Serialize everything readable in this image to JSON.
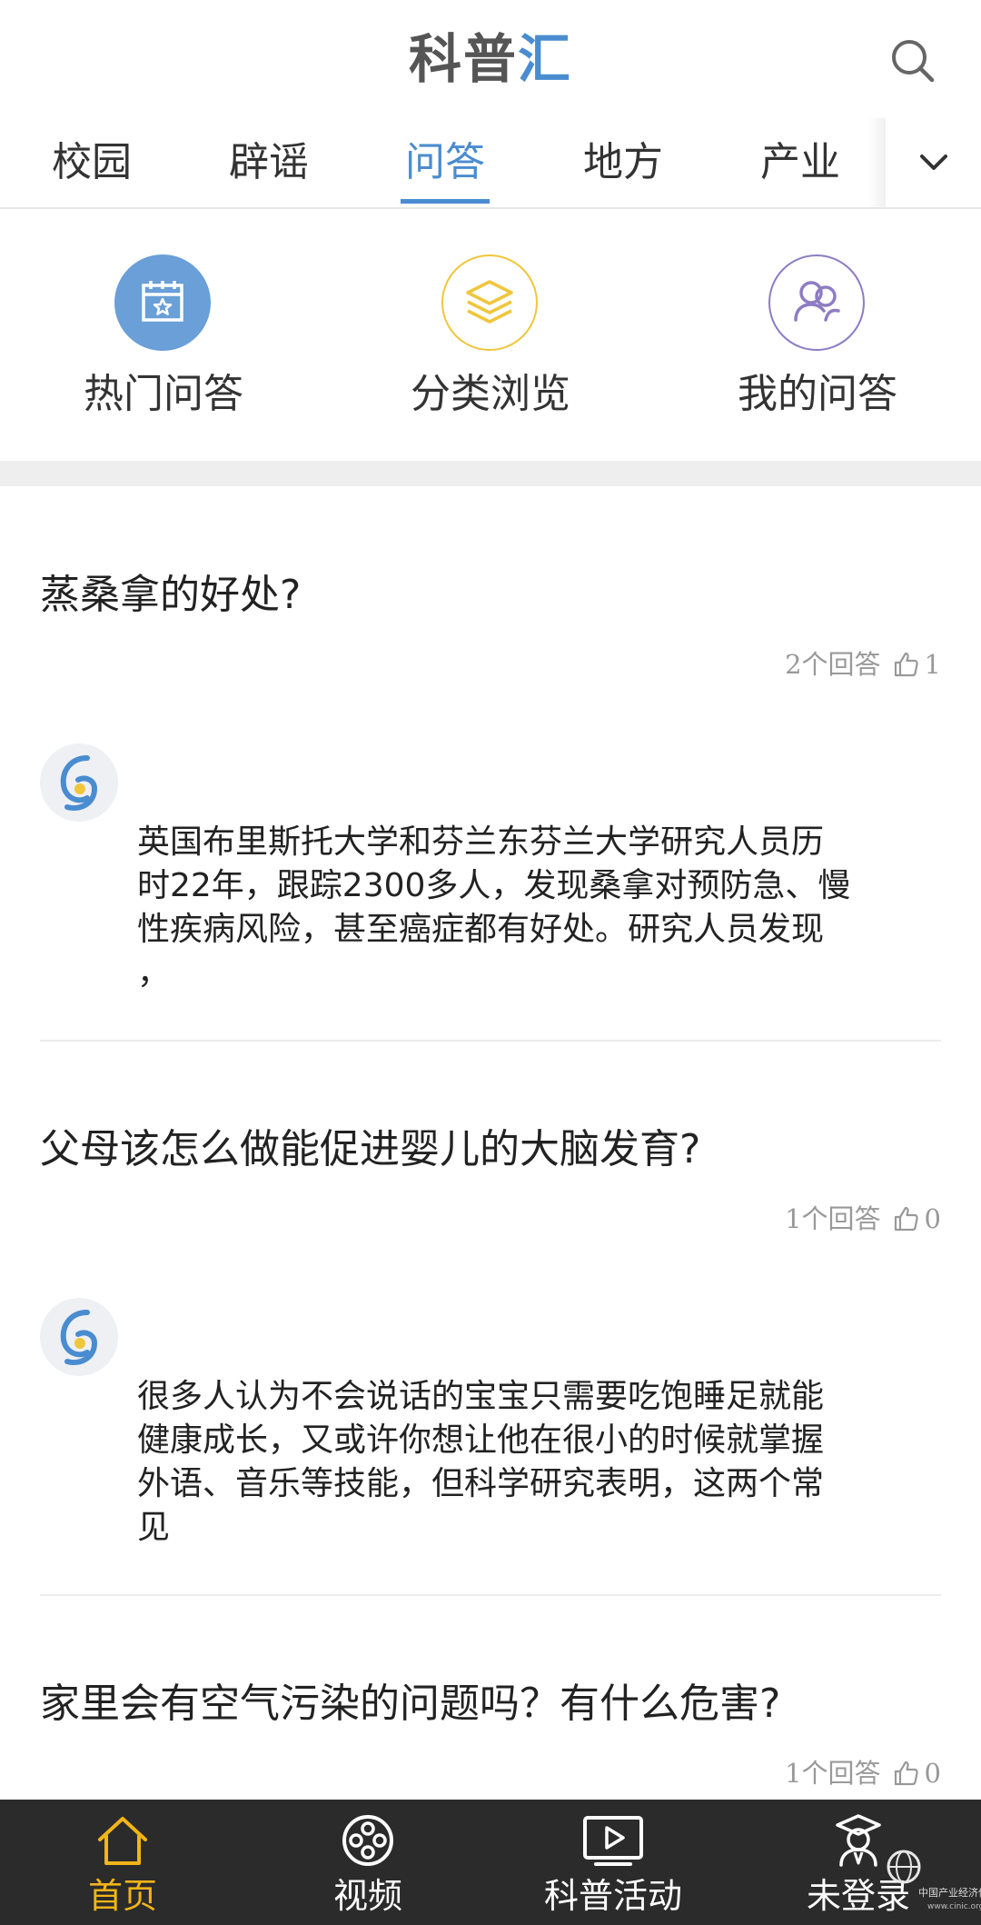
{
  "header": {
    "logo_part1": "科普",
    "logo_part2": "汇",
    "search_icon": "search-icon"
  },
  "tabs": [
    {
      "label": "校园",
      "active": false
    },
    {
      "label": "辟谣",
      "active": false
    },
    {
      "label": "问答",
      "active": true
    },
    {
      "label": "地方",
      "active": false
    },
    {
      "label": "产业",
      "active": false
    }
  ],
  "tabs_more_icon": "chevron-down-icon",
  "quick_entries": [
    {
      "label": "热门问答",
      "icon": "calendar-star-icon",
      "color": "#6a9fd8"
    },
    {
      "label": "分类浏览",
      "icon": "layers-icon",
      "color": "#f0c63c"
    },
    {
      "label": "我的问答",
      "icon": "users-icon",
      "color": "#8e7cc3"
    }
  ],
  "questions": [
    {
      "title": "蒸桑拿的好处?",
      "answers_count": "2个回答",
      "likes": "1",
      "answer_lines": [
        "英国布里斯托大学和芬兰东芬兰大学研究人员历",
        "时22年，跟踪2300多人，发现桑拿对预防急、慢",
        "性疾病风险，甚至癌症都有好处。研究人员发现",
        "，"
      ]
    },
    {
      "title": "父母该怎么做能促进婴儿的大脑发育?",
      "answers_count": "1个回答",
      "likes": "0",
      "answer_lines": [
        "很多人认为不会说话的宝宝只需要吃饱睡足就能",
        "健康成长，又或许你想让他在很小的时候就掌握",
        "外语、音乐等技能，但科学研究表明，这两个常",
        "见"
      ]
    },
    {
      "title": "家里会有空气污染的问题吗？有什么危害?",
      "answers_count": "1个回答",
      "likes": "0"
    }
  ],
  "bottom_nav": [
    {
      "label": "首页",
      "icon": "home-icon",
      "active": true
    },
    {
      "label": "视频",
      "icon": "film-reel-icon",
      "active": false
    },
    {
      "label": "科普活动",
      "icon": "play-screen-icon",
      "active": false
    },
    {
      "label": "未登录",
      "icon": "user-graduate-icon",
      "active": false
    }
  ],
  "watermark": {
    "text": "中国产业经济信息网",
    "sub": "www.cinic.org.cn"
  },
  "colors": {
    "accent": "#4a8cd0",
    "nav_active": "#f2b418",
    "nav_bg": "#2b2b2b",
    "separator": "#eeeeee"
  }
}
